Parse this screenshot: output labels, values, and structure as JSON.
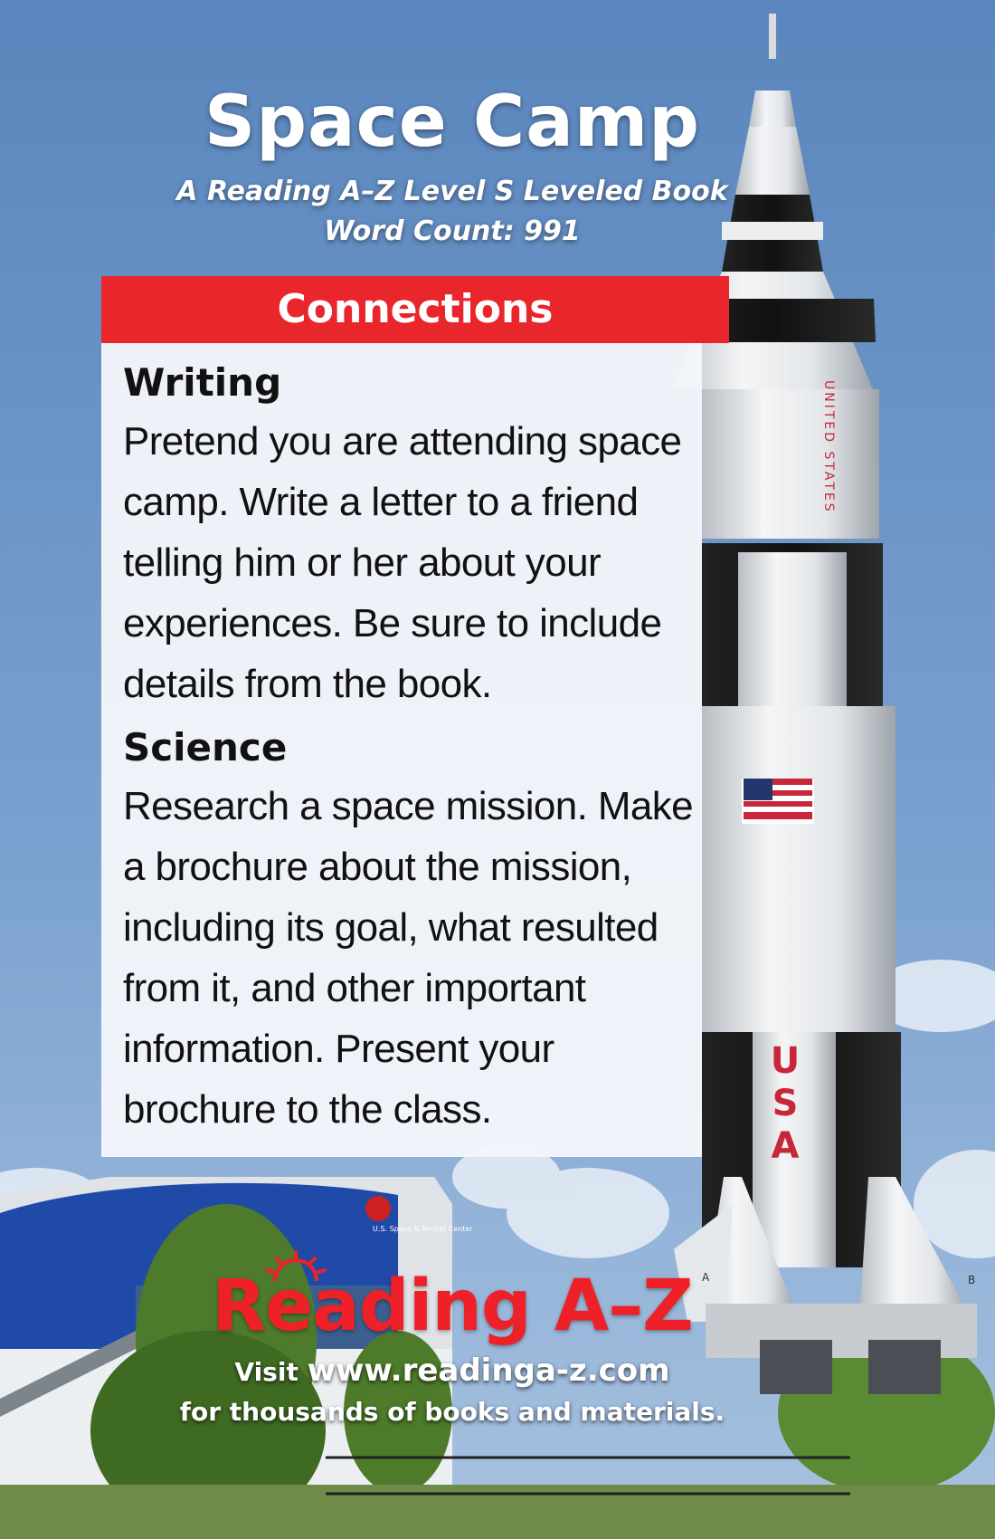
{
  "title": "Space Camp",
  "subtitle_line1": "A Reading A–Z Level S Leveled Book",
  "subtitle_line2": "Word Count: 991",
  "connections": {
    "header": "Connections",
    "sections": [
      {
        "heading": "Writing",
        "text": "Pretend you are attending space camp. Write a letter to a friend telling him or her about your experiences. Be sure to include details from the book."
      },
      {
        "heading": "Science",
        "text": "Research a space mission. Make a brochure about the mission, including its goal, what resulted from it, and other important information. Present your brochure to the class."
      }
    ]
  },
  "rocket_label": [
    "U",
    "S",
    "A"
  ],
  "rocket_vertical_text": "UNITED STATES",
  "building_sign": "U.S. Space & Rocket Center",
  "fin_labels": [
    "A",
    "B"
  ],
  "footer": {
    "logo_text": "Reading A–Z",
    "visit_prefix": "Visit",
    "url": "www.readinga-z.com",
    "tagline": "for thousands of books and materials."
  },
  "colors": {
    "accent_red": "#e8262b",
    "sky_blue": "#6f95c4",
    "building_blue": "#1f4aa8"
  }
}
